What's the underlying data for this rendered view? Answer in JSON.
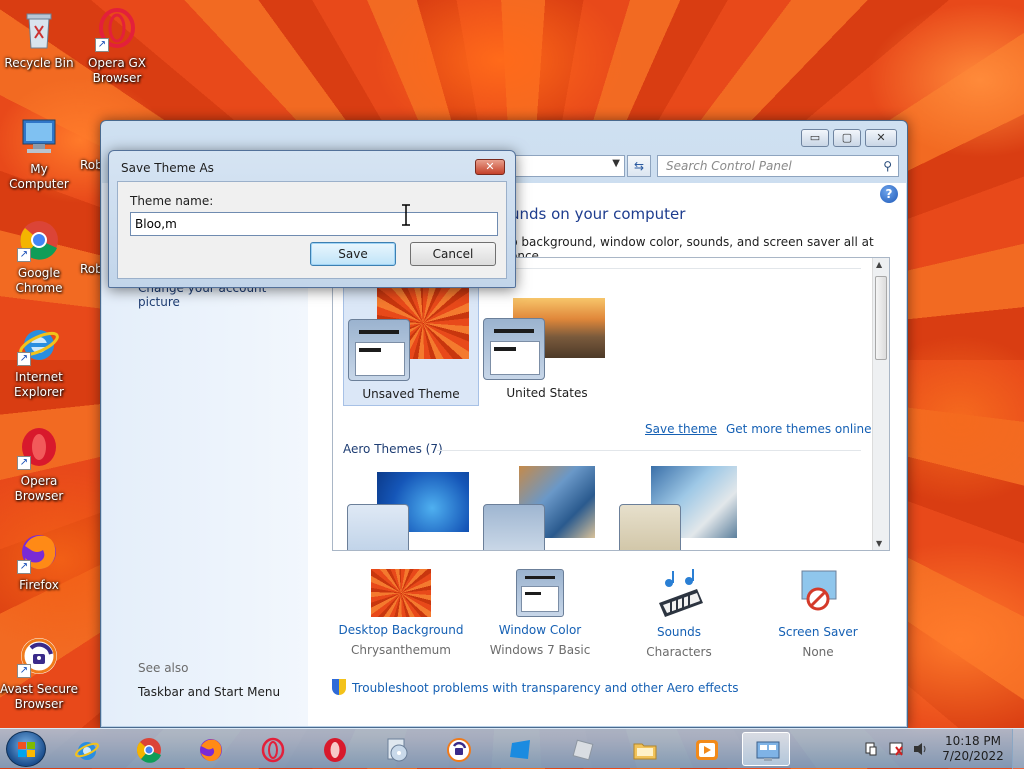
{
  "desktop": {
    "icons": [
      {
        "label": "Recycle Bin"
      },
      {
        "label": "Opera GX Browser"
      },
      {
        "label": "My Computer"
      },
      {
        "label": "Rob"
      },
      {
        "label": "Google Chrome"
      },
      {
        "label": "Rob"
      },
      {
        "label": "Internet Explorer"
      },
      {
        "label": "Opera Browser"
      },
      {
        "label": "Firefox"
      },
      {
        "label": "Avast Secure Browser"
      }
    ]
  },
  "control_panel": {
    "search_placeholder": "Search Control Panel",
    "heading": "unds on your computer",
    "subheading": "p background, window color, sounds, and screen saver all at once.",
    "left_link": "Change your account picture",
    "see_also": "See also",
    "see_also_link": "Taskbar and Start Menu",
    "my_themes": [
      {
        "name": "Unsaved Theme",
        "selected": true
      },
      {
        "name": "United States",
        "selected": false
      }
    ],
    "save_theme_link": "Save theme",
    "get_more_link": "Get more themes online",
    "aero_label": "Aero Themes (7)",
    "bottom_items": [
      {
        "label": "Desktop Background",
        "value": "Chrysanthemum"
      },
      {
        "label": "Window Color",
        "value": "Windows 7 Basic"
      },
      {
        "label": "Sounds",
        "value": "Characters"
      },
      {
        "label": "Screen Saver",
        "value": "None"
      }
    ],
    "troubleshoot_link": "Troubleshoot problems with transparency and other Aero effects"
  },
  "dialog": {
    "title": "Save Theme As",
    "label": "Theme name:",
    "input_value": "Bloo,m",
    "save_label": "Save",
    "cancel_label": "Cancel"
  },
  "taskbar": {
    "clock_time": "10:18 PM",
    "clock_date": "7/20/2022"
  },
  "colors": {
    "link": "#1560b4",
    "heading": "#1e3d8f",
    "taskbar": "#8fb3d3"
  }
}
